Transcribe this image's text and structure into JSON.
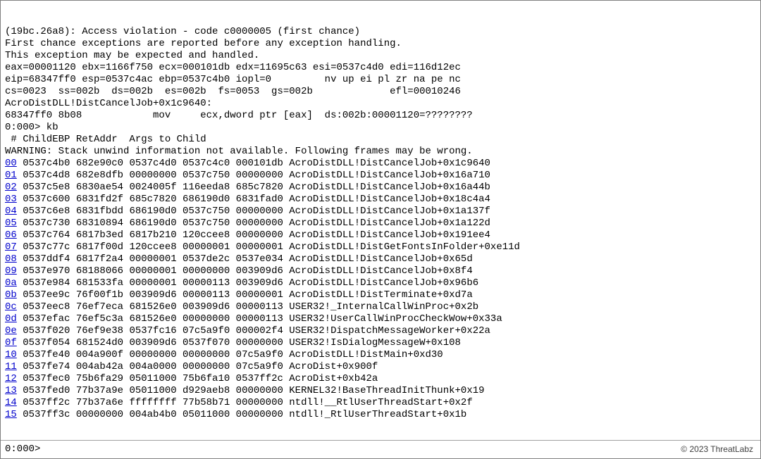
{
  "header_lines": [
    "(19bc.26a8): Access violation - code c0000005 (first chance)",
    "First chance exceptions are reported before any exception handling.",
    "This exception may be expected and handled.",
    "eax=00001120 ebx=1166f750 ecx=000101db edx=11695c63 esi=0537c4d0 edi=116d12ec",
    "eip=68347ff0 esp=0537c4ac ebp=0537c4b0 iopl=0         nv up ei pl zr na pe nc",
    "cs=0023  ss=002b  ds=002b  es=002b  fs=0053  gs=002b             efl=00010246",
    "AcroDistDLL!DistCancelJob+0x1c9640:",
    "68347ff0 8b08            mov     ecx,dword ptr [eax]  ds:002b:00001120=????????",
    "0:000> kb",
    " # ChildEBP RetAddr  Args to Child              ",
    "WARNING: Stack unwind information not available. Following frames may be wrong."
  ],
  "frames": [
    {
      "idx": "00",
      "ebp": "0537c4b0",
      "ret": "682e90c0",
      "a0": "0537c4d0",
      "a1": "0537c4c0",
      "a2": "000101db",
      "sym": "AcroDistDLL!DistCancelJob+0x1c9640"
    },
    {
      "idx": "01",
      "ebp": "0537c4d8",
      "ret": "682e8dfb",
      "a0": "00000000",
      "a1": "0537c750",
      "a2": "00000000",
      "sym": "AcroDistDLL!DistCancelJob+0x16a710"
    },
    {
      "idx": "02",
      "ebp": "0537c5e8",
      "ret": "6830ae54",
      "a0": "0024005f",
      "a1": "116eeda8",
      "a2": "685c7820",
      "sym": "AcroDistDLL!DistCancelJob+0x16a44b"
    },
    {
      "idx": "03",
      "ebp": "0537c600",
      "ret": "6831fd2f",
      "a0": "685c7820",
      "a1": "686190d0",
      "a2": "6831fad0",
      "sym": "AcroDistDLL!DistCancelJob+0x18c4a4"
    },
    {
      "idx": "04",
      "ebp": "0537c6e8",
      "ret": "6831fbdd",
      "a0": "686190d0",
      "a1": "0537c750",
      "a2": "00000000",
      "sym": "AcroDistDLL!DistCancelJob+0x1a137f"
    },
    {
      "idx": "05",
      "ebp": "0537c730",
      "ret": "68310894",
      "a0": "686190d0",
      "a1": "0537c750",
      "a2": "00000000",
      "sym": "AcroDistDLL!DistCancelJob+0x1a122d"
    },
    {
      "idx": "06",
      "ebp": "0537c764",
      "ret": "6817b3ed",
      "a0": "6817b210",
      "a1": "120ccee8",
      "a2": "00000000",
      "sym": "AcroDistDLL!DistCancelJob+0x191ee4"
    },
    {
      "idx": "07",
      "ebp": "0537c77c",
      "ret": "6817f00d",
      "a0": "120ccee8",
      "a1": "00000001",
      "a2": "00000001",
      "sym": "AcroDistDLL!DistGetFontsInFolder+0xe11d"
    },
    {
      "idx": "08",
      "ebp": "0537ddf4",
      "ret": "6817f2a4",
      "a0": "00000001",
      "a1": "0537de2c",
      "a2": "0537e034",
      "sym": "AcroDistDLL!DistCancelJob+0x65d"
    },
    {
      "idx": "09",
      "ebp": "0537e970",
      "ret": "68188066",
      "a0": "00000001",
      "a1": "00000000",
      "a2": "003909d6",
      "sym": "AcroDistDLL!DistCancelJob+0x8f4"
    },
    {
      "idx": "0a",
      "ebp": "0537e984",
      "ret": "681533fa",
      "a0": "00000001",
      "a1": "00000113",
      "a2": "003909d6",
      "sym": "AcroDistDLL!DistCancelJob+0x96b6"
    },
    {
      "idx": "0b",
      "ebp": "0537ee9c",
      "ret": "76f00f1b",
      "a0": "003909d6",
      "a1": "00000113",
      "a2": "00000001",
      "sym": "AcroDistDLL!DistTerminate+0xd7a"
    },
    {
      "idx": "0c",
      "ebp": "0537eec8",
      "ret": "76ef7eca",
      "a0": "681526e0",
      "a1": "003909d6",
      "a2": "00000113",
      "sym": "USER32!_InternalCallWinProc+0x2b"
    },
    {
      "idx": "0d",
      "ebp": "0537efac",
      "ret": "76ef5c3a",
      "a0": "681526e0",
      "a1": "00000000",
      "a2": "00000113",
      "sym": "USER32!UserCallWinProcCheckWow+0x33a"
    },
    {
      "idx": "0e",
      "ebp": "0537f020",
      "ret": "76ef9e38",
      "a0": "0537fc16",
      "a1": "07c5a9f0",
      "a2": "000002f4",
      "sym": "USER32!DispatchMessageWorker+0x22a"
    },
    {
      "idx": "0f",
      "ebp": "0537f054",
      "ret": "681524d0",
      "a0": "003909d6",
      "a1": "0537f070",
      "a2": "00000000",
      "sym": "USER32!IsDialogMessageW+0x108"
    },
    {
      "idx": "10",
      "ebp": "0537fe40",
      "ret": "004a900f",
      "a0": "00000000",
      "a1": "00000000",
      "a2": "07c5a9f0",
      "sym": "AcroDistDLL!DistMain+0xd30"
    },
    {
      "idx": "11",
      "ebp": "0537fe74",
      "ret": "004ab42a",
      "a0": "004a0000",
      "a1": "00000000",
      "a2": "07c5a9f0",
      "sym": "AcroDist+0x900f"
    },
    {
      "idx": "12",
      "ebp": "0537fec0",
      "ret": "75b6fa29",
      "a0": "05011000",
      "a1": "75b6fa10",
      "a2": "0537ff2c",
      "sym": "AcroDist+0xb42a"
    },
    {
      "idx": "13",
      "ebp": "0537fed0",
      "ret": "77b37a9e",
      "a0": "05011000",
      "a1": "d929aeb8",
      "a2": "00000000",
      "sym": "KERNEL32!BaseThreadInitThunk+0x19"
    },
    {
      "idx": "14",
      "ebp": "0537ff2c",
      "ret": "77b37a6e",
      "a0": "ffffffff",
      "a1": "77b58b71",
      "a2": "00000000",
      "sym": "ntdll!__RtlUserThreadStart+0x2f"
    },
    {
      "idx": "15",
      "ebp": "0537ff3c",
      "ret": "00000000",
      "a0": "004ab4b0",
      "a1": "05011000",
      "a2": "00000000",
      "sym": "ntdll!_RtlUserThreadStart+0x1b"
    }
  ],
  "command_bar": {
    "prompt": "0:000> ",
    "value": ""
  },
  "copyright": "© 2023 ThreatLabz"
}
